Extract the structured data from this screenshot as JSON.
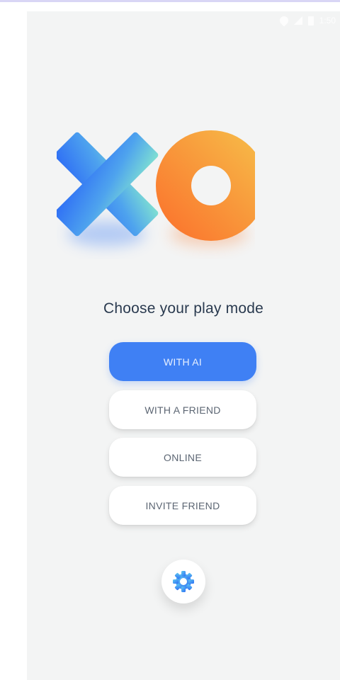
{
  "app": {
    "logo_name": "xo-logo"
  },
  "status_bar": {
    "time": "1:50"
  },
  "main": {
    "heading": "Choose your play mode",
    "buttons": [
      {
        "label": "WITH AI",
        "style": "primary"
      },
      {
        "label": "WITH A FRIEND",
        "style": "secondary"
      },
      {
        "label": "ONLINE",
        "style": "secondary"
      },
      {
        "label": "INVITE FRIEND",
        "style": "secondary"
      }
    ],
    "settings_icon": "gear-icon"
  },
  "colors": {
    "background": "#f3f4f4",
    "primary": "#3f80f4",
    "x_gradient": [
      "#7fe0d2",
      "#2f6ff5"
    ],
    "o_gradient": [
      "#f6c04a",
      "#fb6e2b"
    ]
  }
}
